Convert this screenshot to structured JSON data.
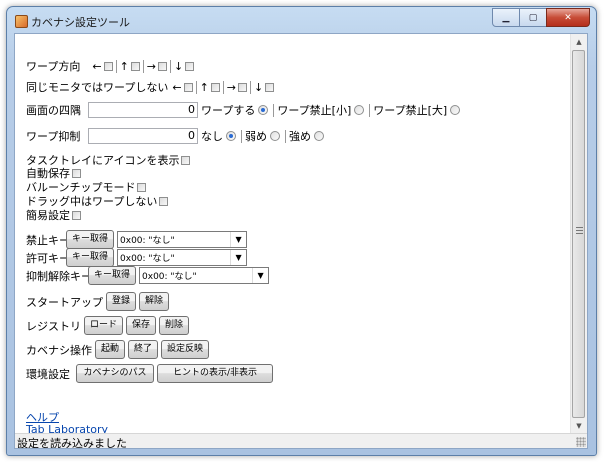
{
  "window": {
    "title": "カベナシ設定ツール",
    "controls": {
      "minimize": "▁",
      "maximize": "▢",
      "close": "✕"
    }
  },
  "warp_direction": {
    "label": "ワープ方向",
    "arrows": [
      "←",
      "↑",
      "→",
      "↓"
    ]
  },
  "same_monitor": {
    "label": "同じモニタではワープしない",
    "arrows": [
      "←",
      "↑",
      "→",
      "↓"
    ]
  },
  "corners": {
    "label": "画面の四隅",
    "value": "0",
    "options": [
      "ワープする",
      "ワープ禁止[小]",
      "ワープ禁止[大]"
    ],
    "selected": "ワープする"
  },
  "suppress": {
    "label": "ワープ抑制",
    "value": "0",
    "options": [
      "なし",
      "弱め",
      "強め"
    ],
    "selected": "なし"
  },
  "checkboxes": [
    "タスクトレイにアイコンを表示",
    "自動保存",
    "バルーンチップモード",
    "ドラッグ中はワープしない",
    "簡易設定"
  ],
  "keys": [
    {
      "label": "禁止キー",
      "button": "キー取得",
      "value": "0x00: \"なし\""
    },
    {
      "label": "許可キー",
      "button": "キー取得",
      "value": "0x00: \"なし\""
    },
    {
      "label": "抑制解除キー",
      "button": "キー取得",
      "value": "0x00: \"なし\""
    }
  ],
  "startup": {
    "label": "スタートアップ",
    "buttons": [
      "登録",
      "解除"
    ]
  },
  "registry": {
    "label": "レジストリ",
    "buttons": [
      "ロード",
      "保存",
      "削除"
    ]
  },
  "operation": {
    "label": "カベナシ操作",
    "buttons": [
      "起動",
      "終了",
      "設定反映"
    ]
  },
  "environment": {
    "label": "環境設定",
    "buttons": [
      "カベナシのパス",
      "ヒントの表示/非表示"
    ]
  },
  "links": {
    "help": "ヘルプ",
    "lab": "Tab Laboratory"
  },
  "status": {
    "text": "設定を読み込みました"
  }
}
